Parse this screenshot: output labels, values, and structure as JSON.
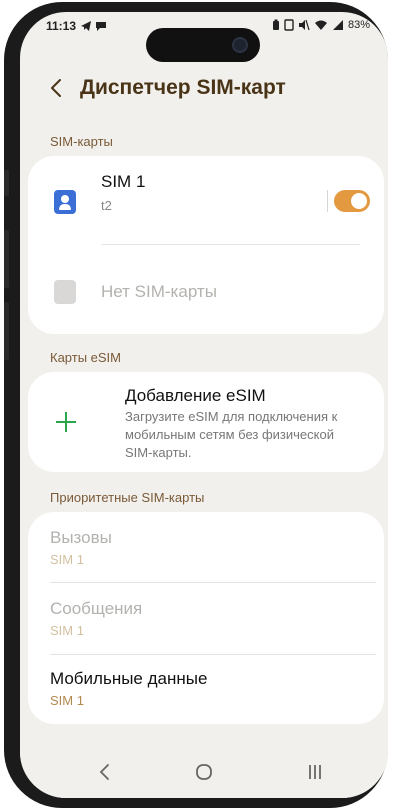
{
  "status_bar": {
    "time": "11:13",
    "left_icons": [
      "telegram-icon",
      "chat-icon"
    ],
    "right_icons": [
      "battery-saver-icon",
      "notification-icon",
      "mute-icon",
      "wifi-icon",
      "signal-icon"
    ],
    "battery": "83%"
  },
  "header": {
    "title": "Диспетчер SIM-карт"
  },
  "sections": {
    "sim_cards": "SIM-карты",
    "esim_cards": "Карты eSIM",
    "priority": "Приоритетные SIM-карты"
  },
  "sim_list": {
    "sim1_name": "SIM 1",
    "sim1_operator": "t2",
    "sim1_enabled": true,
    "no_sim": "Нет SIM-карты"
  },
  "esim": {
    "title": "Добавление eSIM",
    "description": "Загрузите eSIM для подключения к мобильным сетям без физической SIM-карты."
  },
  "priority": {
    "calls_label": "Вызовы",
    "calls_value": "SIM 1",
    "messages_label": "Сообщения",
    "messages_value": "SIM 1",
    "data_label": "Мобильные данные",
    "data_value": "SIM 1"
  },
  "colors": {
    "accent": "#e39940",
    "title": "#4a3418",
    "plus": "#2aa54a",
    "sim_icon": "#3b6fd6"
  }
}
